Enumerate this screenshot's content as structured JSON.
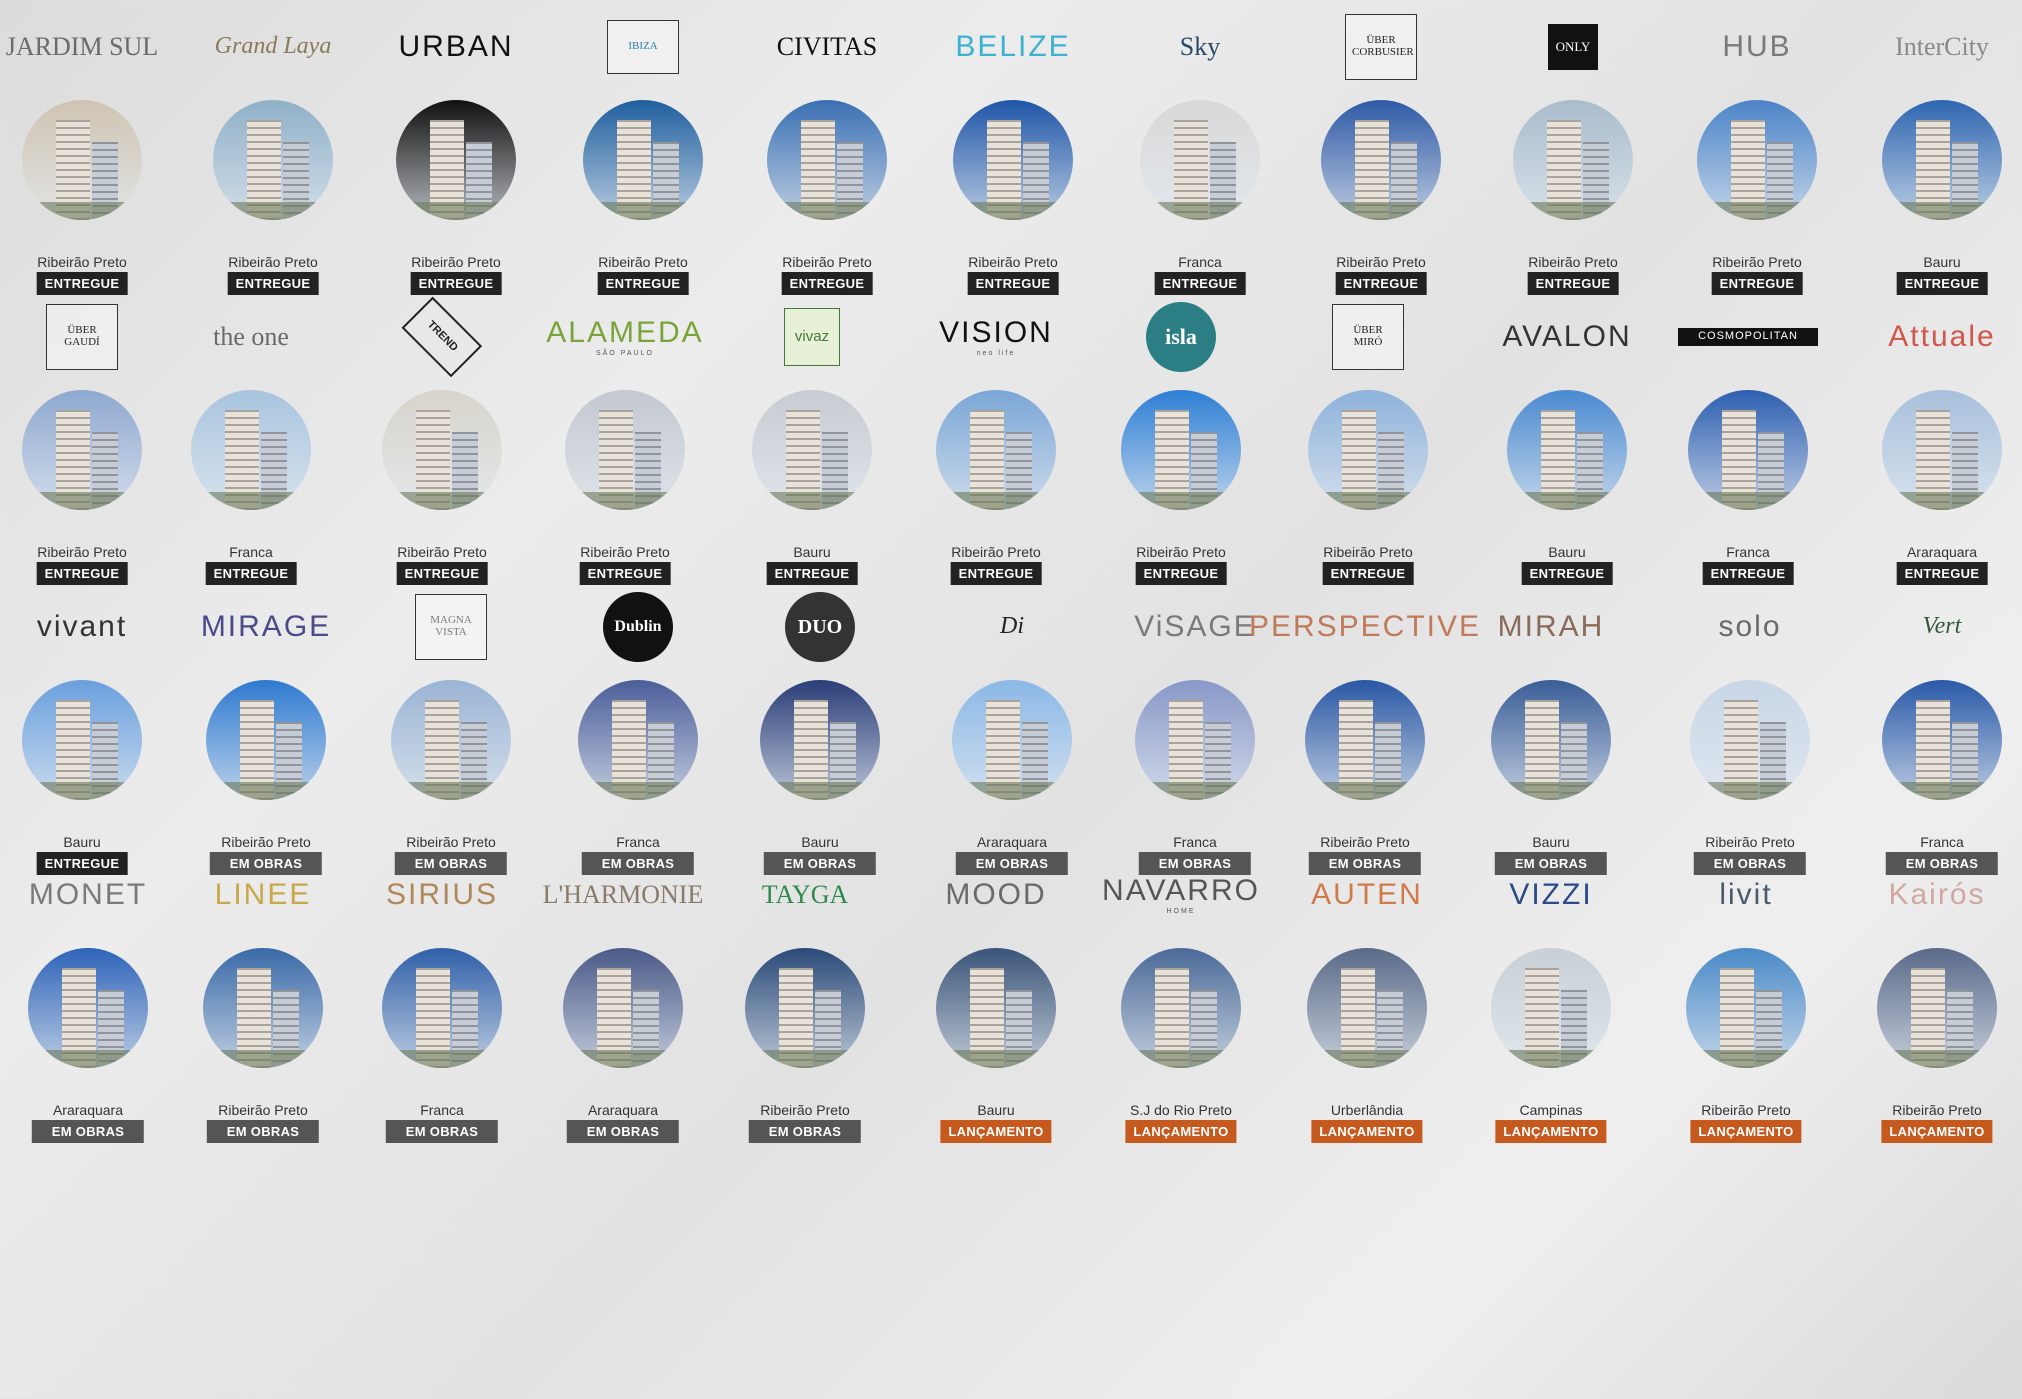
{
  "colors": {
    "entregue": "#222222",
    "em_obras": "#555555",
    "lancamento": "#c65a1e"
  },
  "projects": [
    {
      "logo": "JARDIM SUL",
      "logo_sub": "",
      "logo_color": "#6b6b6b",
      "logo_style": "serif",
      "city": "Ribeirão Preto",
      "status": "ENTREGUE",
      "photo_sky": "#cfc4b2"
    },
    {
      "logo": "Grand Laya",
      "logo_sub": "",
      "logo_color": "#8a7a5a",
      "logo_style": "script",
      "city": "Ribeirão Preto",
      "status": "ENTREGUE",
      "photo_sky": "#8fb0c8"
    },
    {
      "logo": "URBAN",
      "logo_sub": "",
      "logo_color": "#111111",
      "logo_style": "sans",
      "city": "Ribeirão Preto",
      "status": "ENTREGUE",
      "photo_sky": "#101010"
    },
    {
      "logo": "IBIZA",
      "logo_sub": "",
      "logo_color": "#2b7fb2",
      "logo_style": "boxed",
      "city": "Ribeirão Preto",
      "status": "ENTREGUE",
      "photo_sky": "#1f5f9e"
    },
    {
      "logo": "CIVITAS",
      "logo_sub": "",
      "logo_color": "#111111",
      "logo_style": "serif",
      "city": "Ribeirão Preto",
      "status": "ENTREGUE",
      "photo_sky": "#3a6fb2"
    },
    {
      "logo": "BELIZE",
      "logo_sub": "",
      "logo_color": "#3bb2d0",
      "logo_style": "sans",
      "city": "Ribeirão Preto",
      "status": "ENTREGUE",
      "photo_sky": "#1f56a8"
    },
    {
      "logo": "Sky",
      "logo_sub": "",
      "logo_color": "#2a4a6a",
      "logo_style": "serif",
      "city": "Franca",
      "status": "ENTREGUE",
      "photo_sky": "#d8d8d8"
    },
    {
      "logo": "ÜBER CORBUSIER",
      "logo_sub": "",
      "logo_color": "#222222",
      "logo_style": "boxed",
      "city": "Ribeirão Preto",
      "status": "ENTREGUE",
      "photo_sky": "#2f5aa6"
    },
    {
      "logo": "ONLY",
      "logo_sub": "",
      "logo_color": "#ffffff",
      "logo_style": "blackbox",
      "city": "Ribeirão Preto",
      "status": "ENTREGUE",
      "photo_sky": "#a9bccc"
    },
    {
      "logo": "HUB",
      "logo_sub": "",
      "logo_color": "#7a7a7a",
      "logo_style": "sans",
      "city": "Ribeirão Preto",
      "status": "ENTREGUE",
      "photo_sky": "#4c84c8"
    },
    {
      "logo": "InterCity",
      "logo_sub": "",
      "logo_color": "#8a8a8a",
      "logo_style": "serif",
      "city": "Bauru",
      "status": "ENTREGUE",
      "photo_sky": "#2e66b0"
    },
    {
      "logo": "ÜBER GAUDÍ",
      "logo_sub": "",
      "logo_color": "#222222",
      "logo_style": "boxed",
      "city": "Ribeirão Preto",
      "status": "ENTREGUE",
      "photo_sky": "#8ea8d0"
    },
    {
      "logo": "the one",
      "logo_sub": "",
      "logo_color": "#6a6a6a",
      "logo_style": "serif",
      "city": "Franca",
      "status": "ENTREGUE",
      "photo_sky": "#a8c4de"
    },
    {
      "logo": "TREND",
      "logo_sub": "",
      "logo_color": "#222222",
      "logo_style": "diamond",
      "city": "Ribeirão Preto",
      "status": "ENTREGUE",
      "photo_sky": "#d8d4cc"
    },
    {
      "logo": "ALAMEDA",
      "logo_sub": "SÃO PAULO",
      "logo_color": "#7aa33a",
      "logo_style": "sans",
      "city": "Ribeirão Preto",
      "status": "ENTREGUE",
      "photo_sky": "#c4c8d0"
    },
    {
      "logo": "vivaz",
      "logo_sub": "",
      "logo_color": "#3f7a3a",
      "logo_style": "hex",
      "city": "Bauru",
      "status": "ENTREGUE",
      "photo_sky": "#c8ccd2"
    },
    {
      "logo": "VISION",
      "logo_sub": "neo life",
      "logo_color": "#111111",
      "logo_style": "sans",
      "city": "Ribeirão Preto",
      "status": "ENTREGUE",
      "photo_sky": "#7aa6d6"
    },
    {
      "logo": "isla",
      "logo_sub": "",
      "logo_color": "#ffffff",
      "logo_style": "circle-teal",
      "city": "Ribeirão Preto",
      "status": "ENTREGUE",
      "photo_sky": "#2e7fd4"
    },
    {
      "logo": "ÜBER MIRÓ",
      "logo_sub": "",
      "logo_color": "#222222",
      "logo_style": "boxed",
      "city": "Ribeirão Preto",
      "status": "ENTREGUE",
      "photo_sky": "#8eb2da"
    },
    {
      "logo": "AVALON",
      "logo_sub": "",
      "logo_color": "#333333",
      "logo_style": "sans",
      "city": "Bauru",
      "status": "ENTREGUE",
      "photo_sky": "#4a8ad0"
    },
    {
      "logo": "COSMOPOLITAN",
      "logo_sub": "",
      "logo_color": "#ffffff",
      "logo_style": "blackbar",
      "city": "Franca",
      "status": "ENTREGUE",
      "photo_sky": "#2e5fb0"
    },
    {
      "logo": "Attuale",
      "logo_sub": "",
      "logo_color": "#d0584a",
      "logo_style": "sans",
      "city": "Araraquara",
      "status": "ENTREGUE",
      "photo_sky": "#a8c0dc"
    },
    {
      "logo": "vivant",
      "logo_sub": "",
      "logo_color": "#333333",
      "logo_style": "sans",
      "city": "Bauru",
      "status": "ENTREGUE",
      "photo_sky": "#6aa0de"
    },
    {
      "logo": "MIRAGE",
      "logo_sub": "",
      "logo_color": "#4a4a8a",
      "logo_style": "sans",
      "city": "Ribeirão Preto",
      "status": "EM OBRAS",
      "photo_sky": "#2e7ad0"
    },
    {
      "logo": "MAGNA VISTA",
      "logo_sub": "",
      "logo_color": "#7a7a7a",
      "logo_style": "boxed",
      "city": "Ribeirão Preto",
      "status": "EM OBRAS",
      "photo_sky": "#9ab4d4"
    },
    {
      "logo": "Dublin",
      "logo_sub": "",
      "logo_color": "#ffffff",
      "logo_style": "circle-black",
      "city": "Franca",
      "status": "EM OBRAS",
      "photo_sky": "#4a5e9a"
    },
    {
      "logo": "DUO",
      "logo_sub": "",
      "logo_color": "#ffffff",
      "logo_style": "circle-dark",
      "city": "Bauru",
      "status": "EM OBRAS",
      "photo_sky": "#2a3e78"
    },
    {
      "logo": "Di",
      "logo_sub": "",
      "logo_color": "#222222",
      "logo_style": "script",
      "city": "Araraquara",
      "status": "EM OBRAS",
      "photo_sky": "#8ab8e6"
    },
    {
      "logo": "ViSAGE",
      "logo_sub": "",
      "logo_color": "#7a7a7a",
      "logo_style": "sans",
      "city": "Franca",
      "status": "EM OBRAS",
      "photo_sky": "#8898c8"
    },
    {
      "logo": "PERSPECTIVE",
      "logo_sub": "",
      "logo_color": "#c07a5a",
      "logo_style": "sans",
      "city": "Ribeirão Preto",
      "status": "EM OBRAS",
      "photo_sky": "#2a58a4"
    },
    {
      "logo": "MIRAH",
      "logo_sub": "",
      "logo_color": "#8a6a5a",
      "logo_style": "sans",
      "city": "Bauru",
      "status": "EM OBRAS",
      "photo_sky": "#3a5e98"
    },
    {
      "logo": "solo",
      "logo_sub": "",
      "logo_color": "#6a6a6a",
      "logo_style": "sans",
      "city": "Ribeirão Preto",
      "status": "EM OBRAS",
      "photo_sky": "#c8d6e6"
    },
    {
      "logo": "Vert",
      "logo_sub": "",
      "logo_color": "#2e5a3a",
      "logo_style": "script",
      "city": "Franca",
      "status": "EM OBRAS",
      "photo_sky": "#2a5aa8"
    },
    {
      "logo": "MONET",
      "logo_sub": "",
      "logo_color": "#7a7a7a",
      "logo_style": "sans",
      "city": "Araraquara",
      "status": "EM OBRAS",
      "photo_sky": "#2e64b8"
    },
    {
      "logo": "LINEE",
      "logo_sub": "",
      "logo_color": "#c8a84a",
      "logo_style": "sans",
      "city": "Ribeirão Preto",
      "status": "EM OBRAS",
      "photo_sky": "#3a6aa8"
    },
    {
      "logo": "SIRIUS",
      "logo_sub": "",
      "logo_color": "#b0885a",
      "logo_style": "sans",
      "city": "Franca",
      "status": "EM OBRAS",
      "photo_sky": "#3060a8"
    },
    {
      "logo": "L'HARMONIE",
      "logo_sub": "",
      "logo_color": "#8a7a6a",
      "logo_style": "serif",
      "city": "Araraquara",
      "status": "EM OBRAS",
      "photo_sky": "#4a5a88"
    },
    {
      "logo": "TAYGA",
      "logo_sub": "",
      "logo_color": "#2e8a4a",
      "logo_style": "serif",
      "city": "Ribeirão Preto",
      "status": "EM OBRAS",
      "photo_sky": "#2a4a78"
    },
    {
      "logo": "MOOD",
      "logo_sub": "",
      "logo_color": "#6a6a6a",
      "logo_style": "sans",
      "city": "Bauru",
      "status": "LANÇAMENTO",
      "photo_sky": "#3a5478"
    },
    {
      "logo": "NAVARRO",
      "logo_sub": "HOME",
      "logo_color": "#555555",
      "logo_style": "sans",
      "city": "S.J do Rio Preto",
      "status": "LANÇAMENTO",
      "photo_sky": "#4a6a98"
    },
    {
      "logo": "AUTEN",
      "logo_sub": "",
      "logo_color": "#d07a4a",
      "logo_style": "sans",
      "city": "Urberlândia",
      "status": "LANÇAMENTO",
      "photo_sky": "#5a6a88"
    },
    {
      "logo": "VIZZI",
      "logo_sub": "",
      "logo_color": "#2a4a8a",
      "logo_style": "sans",
      "city": "Campinas",
      "status": "LANÇAMENTO",
      "photo_sky": "#c8d0d6"
    },
    {
      "logo": "livit",
      "logo_sub": "",
      "logo_color": "#4a5a6a",
      "logo_style": "sans",
      "city": "Ribeirão Preto",
      "status": "LANÇAMENTO",
      "photo_sky": "#4a8ac8"
    },
    {
      "logo": "Kairós",
      "logo_sub": "",
      "logo_color": "#d0a8a0",
      "logo_style": "sans",
      "city": "Ribeirão Preto",
      "status": "LANÇAMENTO",
      "photo_sky": "#5a6a8a"
    }
  ]
}
